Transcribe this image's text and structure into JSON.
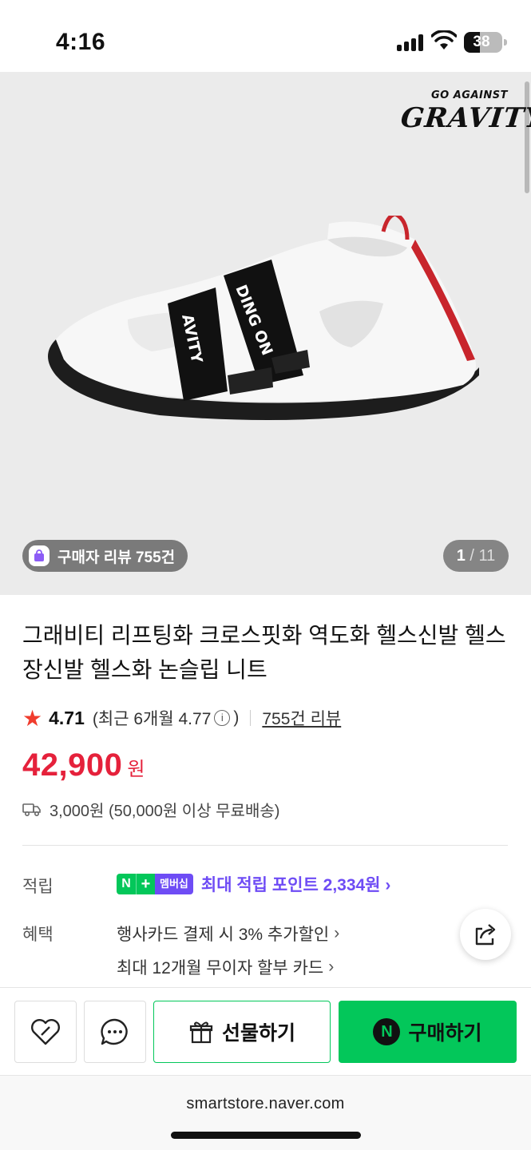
{
  "status_bar": {
    "time": "4:16",
    "battery": "38"
  },
  "hero": {
    "brand_top": "GO AGAINST",
    "brand_main": "GRAVITY",
    "review_pill": "구매자 리뷰 755건",
    "page_current": "1",
    "page_sep": "/",
    "page_total": "11"
  },
  "product": {
    "title": "그래비티 리프팅화 크로스핏화 역도화 헬스신발 헬스장신발 헬스화 논슬립 니트",
    "rating": "4.71",
    "recent_rating": "(최근 6개월 4.77",
    "recent_close": ")",
    "reviews_link": "755건 리뷰",
    "price": "42,900",
    "price_unit": "원",
    "shipping": "3,000원 (50,000원 이상 무료배송)"
  },
  "details": {
    "points_label": "적립",
    "badge_n": "N",
    "badge_plus": "+",
    "badge_membership": "멤버십",
    "points_text": "최대 적립 포인트 2,334원 ›",
    "benefits_label": "혜택",
    "benefit_1": "행사카드 결제 시 3% 추가할인",
    "benefit_2": "최대 12개월 무이자 할부 카드"
  },
  "actions": {
    "gift_label": "선물하기",
    "buy_label": "구매하기",
    "buy_badge": "N"
  },
  "browser": {
    "url": "smartstore.naver.com"
  },
  "colors": {
    "price": "#e5213b",
    "naver_green": "#03c75a",
    "membership_purple": "#6e4cf5",
    "star": "#f03c2d"
  }
}
